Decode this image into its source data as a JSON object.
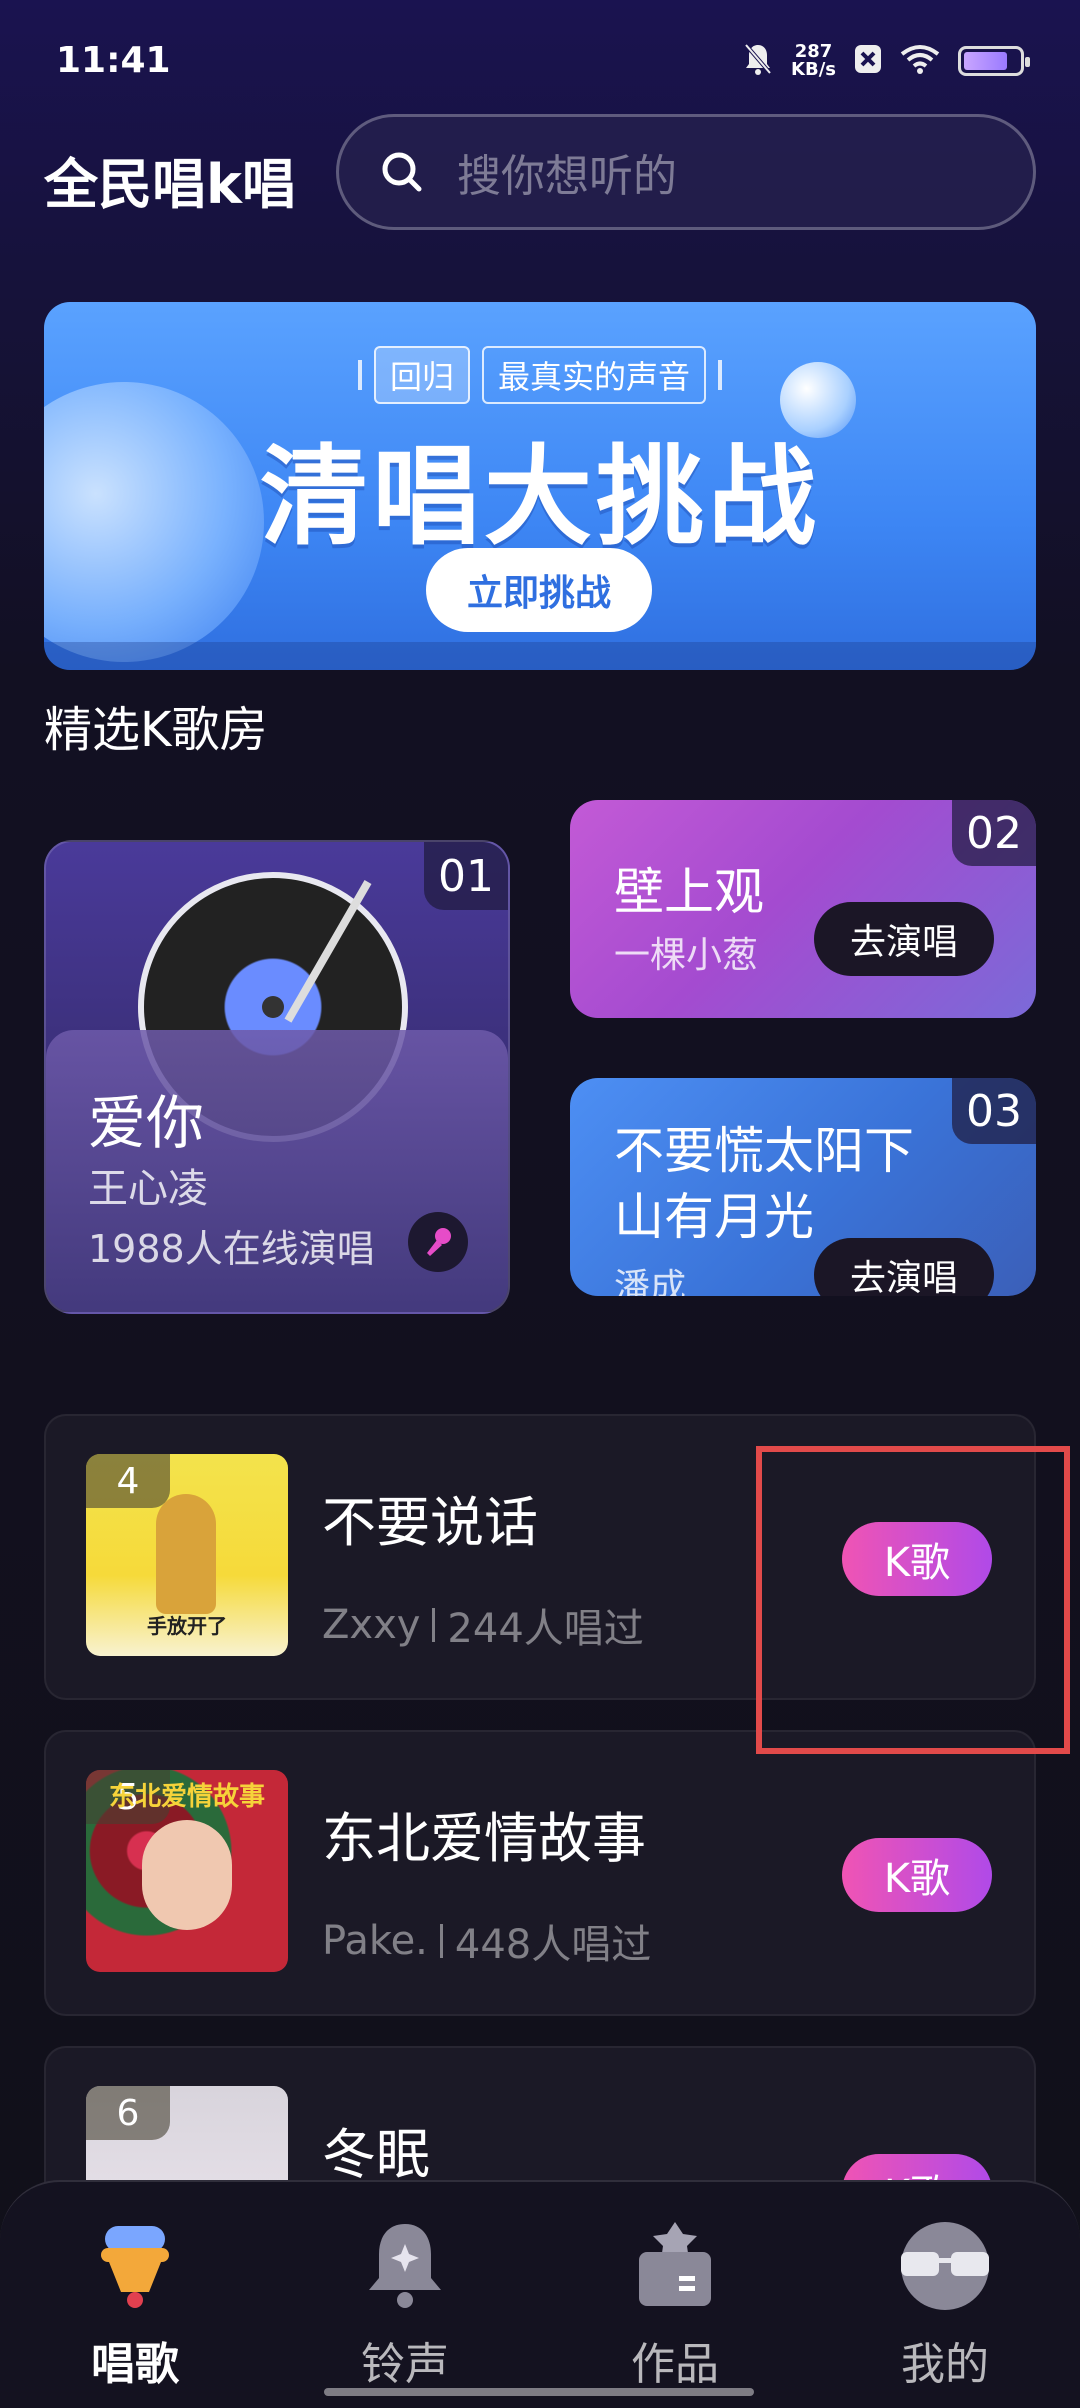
{
  "status_bar": {
    "time": "11:41",
    "net_speed_value": "287",
    "net_speed_unit": "KB/s",
    "icons": [
      "bell-muted-icon",
      "close-box-icon",
      "wifi-icon",
      "battery-icon"
    ]
  },
  "header": {
    "app_title": "全民唱k唱",
    "search_placeholder": "搜你想听的"
  },
  "banner": {
    "tag_left": "回归",
    "tag_right": "最真实的声音",
    "title": "清唱大挑战",
    "button": "立即挑战"
  },
  "rooms_section": {
    "title": "精选K歌房",
    "featured": {
      "number": "01",
      "song": "爱你",
      "artist": "王心凌",
      "online": "1988人在线演唱"
    },
    "rooms": [
      {
        "number": "02",
        "song": "壁上观",
        "artist": "一棵小葱",
        "button": "去演唱"
      },
      {
        "number": "03",
        "song": "不要慌太阳下山有月光",
        "artist": "潘成",
        "button": "去演唱"
      }
    ]
  },
  "songs": [
    {
      "rank": "4",
      "name": "不要说话",
      "artist": "Zxxy",
      "sung": "244人唱过",
      "button": "K歌",
      "cover_text": "手放开了"
    },
    {
      "rank": "5",
      "name": "东北爱情故事",
      "artist": "Pake.",
      "sung": "448人唱过",
      "button": "K歌",
      "cover_text": "东北爱情故事"
    },
    {
      "rank": "6",
      "name": "冬眠",
      "artist": "",
      "sung": "",
      "button": "K歌",
      "cover_text": ""
    }
  ],
  "bottom_nav": [
    {
      "label": "唱歌",
      "icon": "microphone-icon",
      "active": true
    },
    {
      "label": "铃声",
      "icon": "bell-icon",
      "active": false
    },
    {
      "label": "作品",
      "icon": "works-box-icon",
      "active": false
    },
    {
      "label": "我的",
      "icon": "avatar-glasses-icon",
      "active": false
    }
  ],
  "colors": {
    "accent_gradient_start": "#f054b4",
    "accent_gradient_end": "#b04ae8",
    "highlight": "#e24a4a"
  }
}
